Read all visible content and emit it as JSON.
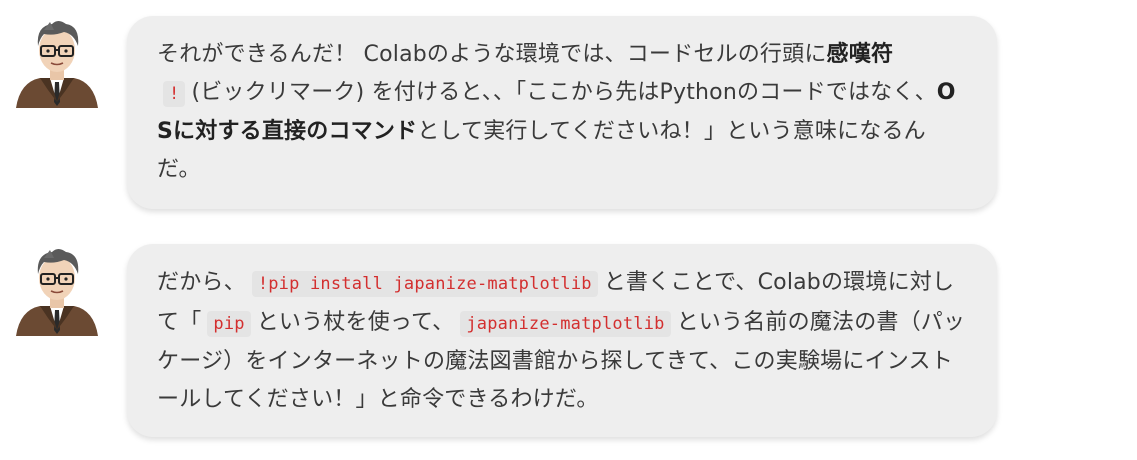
{
  "messages": [
    {
      "segments": [
        {
          "type": "text",
          "value": "それができるんだ！ Colabのような環境では、コードセルの行頭に"
        },
        {
          "type": "bold",
          "value": "感嘆符"
        },
        {
          "type": "code",
          "value": "!"
        },
        {
          "type": "text",
          "value": "(ビックリマーク) を付けると、、「ここから先はPythonのコードではなく、"
        },
        {
          "type": "bold",
          "value": "OSに対する直接のコマンド"
        },
        {
          "type": "text",
          "value": "として実行してくださいね！」という意味になるんだ。"
        }
      ]
    },
    {
      "segments": [
        {
          "type": "text",
          "value": "だから、"
        },
        {
          "type": "code",
          "value": "!pip install japanize-matplotlib"
        },
        {
          "type": "text",
          "value": "と書くことで、Colabの環境に対して「"
        },
        {
          "type": "code",
          "value": "pip"
        },
        {
          "type": "text",
          "value": "という杖を使って、"
        },
        {
          "type": "code",
          "value": "japanize-matplotlib"
        },
        {
          "type": "text",
          "value": "という名前の魔法の書（パッケージ）をインターネットの魔法図書館から探してきて、この実験場にインストールしてください！」と命令できるわけだ。"
        }
      ]
    }
  ]
}
